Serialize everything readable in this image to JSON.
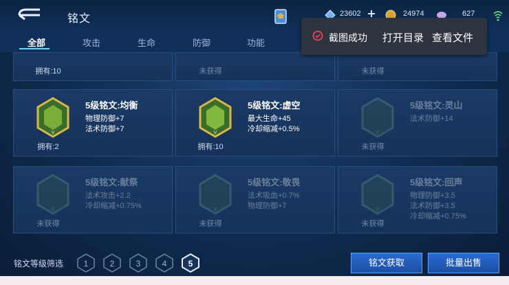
{
  "header": {
    "title": "铭文"
  },
  "currencies": [
    {
      "name": "diamond",
      "value": "23602",
      "icon": "diamond-icon"
    },
    {
      "name": "gold",
      "value": "24974",
      "icon": "coin-icon"
    },
    {
      "name": "gem",
      "value": "627",
      "icon": "gem-icon"
    }
  ],
  "tabs": [
    "全部",
    "攻击",
    "生命",
    "防御",
    "功能"
  ],
  "toast": {
    "message": "截图成功",
    "open_label": "打开目录",
    "view_label": "查看文件"
  },
  "cards_top_partial": [
    {
      "own": "拥有:10",
      "dim": false
    },
    {
      "own": "未获得",
      "dim": true
    },
    {
      "own": "未获得",
      "dim": true
    }
  ],
  "cards": [
    {
      "name": "5级铭文:均衡",
      "stats": [
        "物理防御+7",
        "法术防御+7"
      ],
      "own": "拥有:2",
      "dim": false,
      "color": "#c8a53a"
    },
    {
      "name": "5级铭文:虚空",
      "stats": [
        "最大生命+45",
        "冷却缩减+0.5%"
      ],
      "own": "拥有:10",
      "dim": false,
      "color": "#c8a53a"
    },
    {
      "name": "5级铭文:灵山",
      "stats": [
        "法术防御+14"
      ],
      "own": "未获得",
      "dim": true,
      "color": "#3b6a5a"
    },
    {
      "name": "5级铭文:献祭",
      "stats": [
        "法术攻击+2.2",
        "冷却缩减+0.75%"
      ],
      "own": "未获得",
      "dim": true,
      "color": "#3b6a5a"
    },
    {
      "name": "5级铭文:敬畏",
      "stats": [
        "法术吸血+0.7%",
        "物理防御+7"
      ],
      "own": "未获得",
      "dim": true,
      "color": "#3b6a5a"
    },
    {
      "name": "5级铭文:回声",
      "stats": [
        "物理防御+3.5",
        "法术防御+3.5",
        "冷却缩减+0.75%"
      ],
      "own": "未获得",
      "dim": true,
      "color": "#3b6a5a"
    }
  ],
  "filter": {
    "label": "铭文等级筛选",
    "levels": [
      "1",
      "2",
      "3",
      "4",
      "5"
    ],
    "selected": "5"
  },
  "buttons": {
    "acquire": "铭文获取",
    "sell": "批量出售"
  }
}
